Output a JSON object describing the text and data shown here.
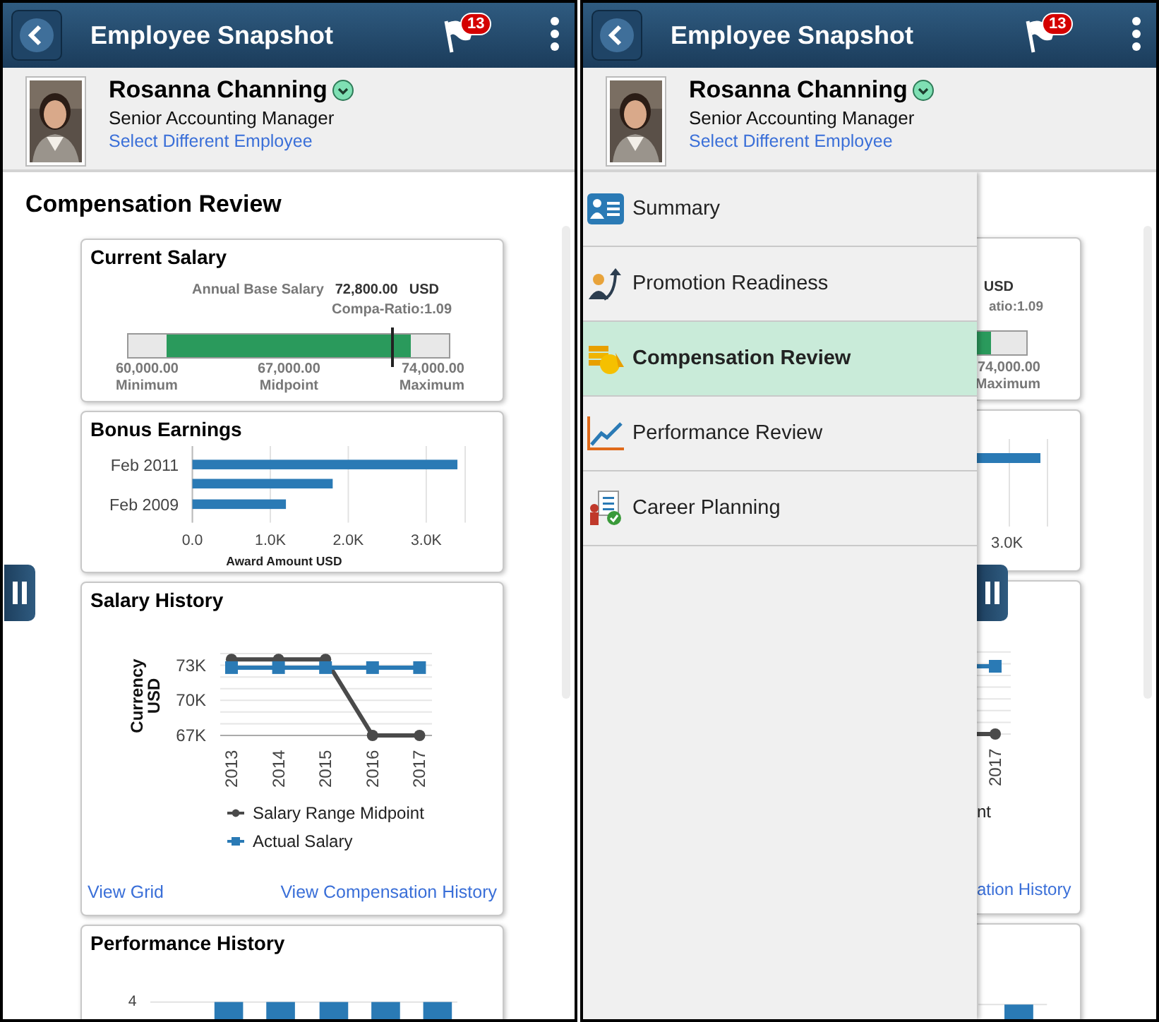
{
  "screens": [
    {
      "header": {
        "title": "Employee Snapshot",
        "badge": "13"
      },
      "employee": {
        "name": "Rosanna Channing",
        "job": "Senior Accounting Manager",
        "link": "Select Different Employee"
      },
      "section_title": "Compensation Review",
      "current_salary": {
        "title": "Current Salary",
        "salary_label": "Annual Base Salary",
        "salary": "72,800.00",
        "currency": "USD",
        "ratio": "Compa-Ratio:1.09",
        "level": 0.82,
        "scale": [
          {
            "value": "60,000.00",
            "label": "Minimum"
          },
          {
            "value": "67,000.00",
            "label": "Midpoint"
          },
          {
            "value": "74,000.00",
            "label": "Maximum"
          }
        ]
      },
      "bonus_earnings": {
        "title": "Bonus Earnings",
        "chart_data": {
          "type": "bar",
          "orientation": "horizontal",
          "xlabel": "Award Amount USD",
          "categories": [
            "Feb 2011",
            null,
            "Feb 2009"
          ],
          "values": [
            3400,
            1800,
            1200
          ],
          "xlim": [
            0,
            3500
          ],
          "grid": true,
          "xticks": [
            {
              "value": 0,
              "label": "0.0"
            },
            {
              "value": 1000,
              "label": "1.0K"
            },
            {
              "value": 2000,
              "label": "2.0K"
            },
            {
              "value": 3000,
              "label": "3.0K"
            }
          ]
        }
      },
      "salary_history": {
        "title": "Salary History",
        "chart_data": {
          "type": "line",
          "ylabel": "Currency USD",
          "x": [
            "2013",
            "2014",
            "2015",
            "2016",
            "2017"
          ],
          "series": [
            {
              "name": "Salary Range Midpoint",
              "color": "#4a4a4a",
              "marker": "circle",
              "values": [
                73500,
                73500,
                73500,
                67000,
                67000
              ]
            },
            {
              "name": "Actual Salary",
              "color": "#2a7ab5",
              "marker": "square",
              "values": [
                72800,
                72800,
                72800,
                72800,
                72800
              ]
            }
          ],
          "ylim": [
            67000,
            74000
          ],
          "grid": true,
          "yticks": [
            {
              "value": 67000,
              "label": "67K"
            },
            {
              "value": 70000,
              "label": "70K"
            },
            {
              "value": 73000,
              "label": "73K"
            }
          ]
        },
        "links": [
          "View Grid",
          "View Compensation History"
        ]
      },
      "performance_history": {
        "title": "Performance History",
        "ytick": "4"
      }
    },
    {
      "header": {
        "title": "Employee Snapshot",
        "badge": "13"
      },
      "employee": {
        "name": "Rosanna Channing",
        "job": "Senior Accounting Manager",
        "link": "Select Different Employee"
      },
      "menu": {
        "items": [
          {
            "label": "Summary",
            "selected": false
          },
          {
            "label": "Promotion Readiness",
            "selected": false
          },
          {
            "label": "Compensation Review",
            "selected": true
          },
          {
            "label": "Performance Review",
            "selected": false
          },
          {
            "label": "Career Planning",
            "selected": false
          }
        ]
      },
      "peek": {
        "currency": "USD",
        "ratio": "atio:1.09",
        "max_value": "74,000.00",
        "max_label": "Maximum",
        "bonus_tick": "3.0K",
        "year": "2017",
        "legend_fragment": "nt",
        "link": "ation History"
      }
    }
  ]
}
